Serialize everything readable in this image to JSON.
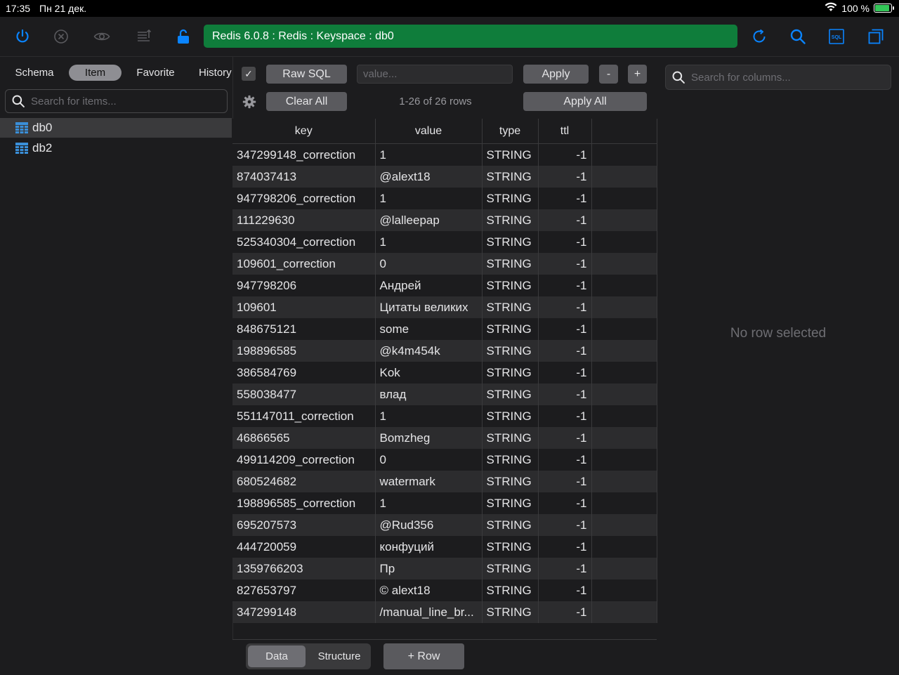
{
  "status_bar": {
    "time": "17:35",
    "date": "Пн 21 дек.",
    "battery": "100 %",
    "battery_level": 1.0
  },
  "connection_title": "Redis 6.0.8 : Redis : Keyspace : db0",
  "accent_color": "#0a84ff",
  "connection_color": "#0f7d3b",
  "toolbar_icons": [
    "power-icon",
    "close-circle-icon",
    "eye-icon",
    "list-sort-icon",
    "unlock-icon",
    "refresh-icon",
    "search-icon",
    "sql-icon",
    "window-icon"
  ],
  "sidebar": {
    "tabs": [
      {
        "label": "Schema"
      },
      {
        "label": "Item"
      },
      {
        "label": "Favorite"
      },
      {
        "label": "History"
      }
    ],
    "active_tab": "Item",
    "search_placeholder": "Search for items...",
    "items": [
      {
        "label": "db0",
        "selected": true
      },
      {
        "label": "db2",
        "selected": false
      }
    ]
  },
  "filter": {
    "checkbox_glyph": "✓",
    "raw_sql_label": "Raw SQL",
    "value_placeholder": "value...",
    "apply_label": "Apply",
    "minus_label": "-",
    "plus_label": "+",
    "clear_all_label": "Clear All",
    "rows_count": "1-26 of 26 rows",
    "apply_all_label": "Apply All"
  },
  "table": {
    "columns": [
      "key",
      "value",
      "type",
      "ttl"
    ],
    "rows": [
      [
        "347299148_correction",
        "1",
        "STRING",
        "-1"
      ],
      [
        "874037413",
        "@alext18",
        "STRING",
        "-1"
      ],
      [
        "947798206_correction",
        "1",
        "STRING",
        "-1"
      ],
      [
        "111229630",
        "@lalleepap",
        "STRING",
        "-1"
      ],
      [
        "525340304_correction",
        "1",
        "STRING",
        "-1"
      ],
      [
        "109601_correction",
        "0",
        "STRING",
        "-1"
      ],
      [
        "947798206",
        "Андрей",
        "STRING",
        "-1"
      ],
      [
        "109601",
        "Цитаты великих",
        "STRING",
        "-1"
      ],
      [
        "848675121",
        "some",
        "STRING",
        "-1"
      ],
      [
        "198896585",
        "@k4m454k",
        "STRING",
        "-1"
      ],
      [
        "386584769",
        "Kok",
        "STRING",
        "-1"
      ],
      [
        "558038477",
        "влад",
        "STRING",
        "-1"
      ],
      [
        "551147011_correction",
        "1",
        "STRING",
        "-1"
      ],
      [
        "46866565",
        "Bomzheg",
        "STRING",
        "-1"
      ],
      [
        "499114209_correction",
        "0",
        "STRING",
        "-1"
      ],
      [
        "680524682",
        "watermark",
        "STRING",
        "-1"
      ],
      [
        "198896585_correction",
        "1",
        "STRING",
        "-1"
      ],
      [
        "695207573",
        "@Rud356",
        "STRING",
        "-1"
      ],
      [
        "444720059",
        "конфуций",
        "STRING",
        "-1"
      ],
      [
        "1359766203",
        "Пр",
        "STRING",
        "-1"
      ],
      [
        "827653797",
        "© alext18",
        "STRING",
        "-1"
      ],
      [
        "347299148",
        "/manual_line_br...",
        "STRING",
        "-1"
      ]
    ]
  },
  "bottom": {
    "data_label": "Data",
    "structure_label": "Structure",
    "add_row_label": "+ Row",
    "active": "Data"
  },
  "right_panel": {
    "search_placeholder": "Search for columns...",
    "empty_text": "No row selected"
  }
}
